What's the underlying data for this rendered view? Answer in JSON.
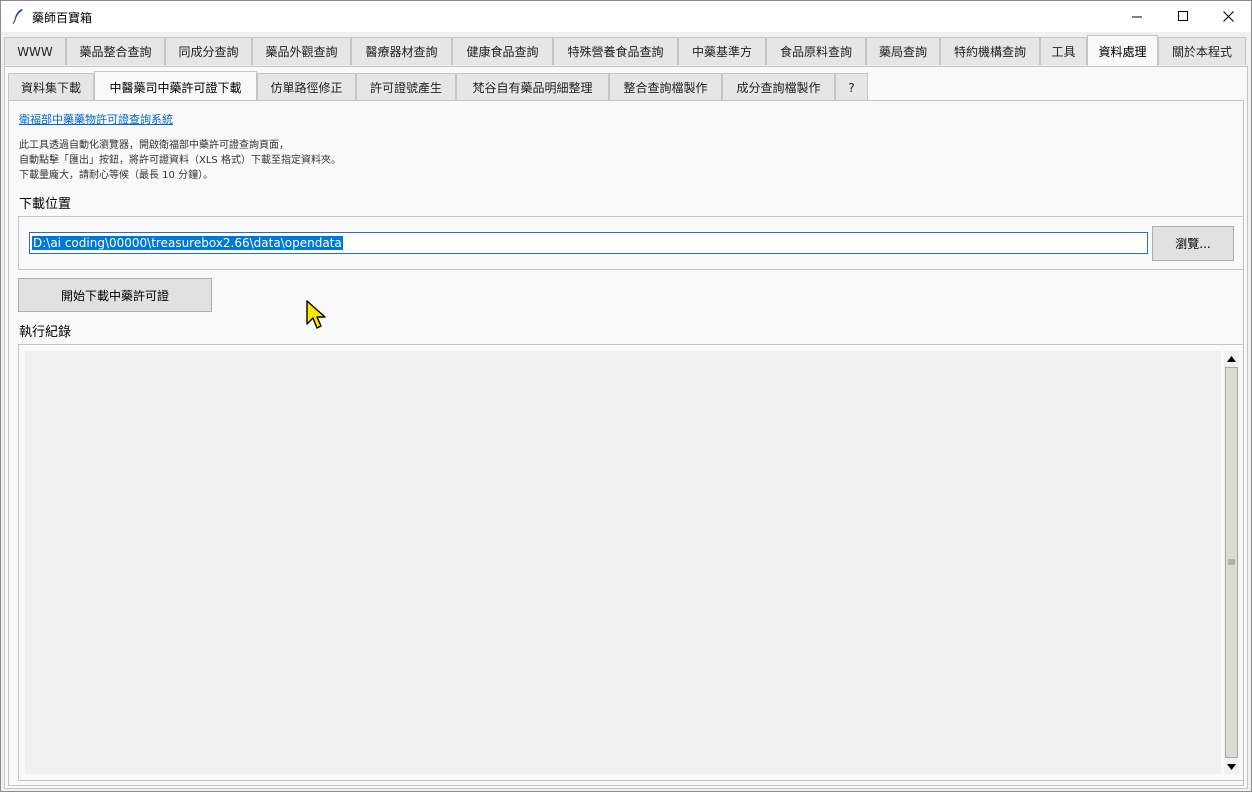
{
  "window": {
    "title": "藥師百寶箱",
    "icon": "feather-icon",
    "controls": [
      "minimize-icon",
      "maximize-icon",
      "close-icon"
    ]
  },
  "main_tabs": [
    {
      "label": "WWW",
      "selected": false
    },
    {
      "label": "藥品整合查詢",
      "selected": false
    },
    {
      "label": "同成分查詢",
      "selected": false
    },
    {
      "label": "藥品外觀查詢",
      "selected": false
    },
    {
      "label": "醫療器材查詢",
      "selected": false
    },
    {
      "label": "健康食品查詢",
      "selected": false
    },
    {
      "label": "特殊營養食品查詢",
      "selected": false
    },
    {
      "label": "中藥基準方",
      "selected": false
    },
    {
      "label": "食品原料查詢",
      "selected": false
    },
    {
      "label": "藥局查詢",
      "selected": false
    },
    {
      "label": "特約機構查詢",
      "selected": false
    },
    {
      "label": "工具",
      "selected": false
    },
    {
      "label": "資料處理",
      "selected": true
    },
    {
      "label": "關於本程式",
      "selected": false
    }
  ],
  "sub_tabs": [
    {
      "label": "資料集下載",
      "selected": false
    },
    {
      "label": "中醫藥司中藥許可證下載",
      "selected": true
    },
    {
      "label": "仿單路徑修正",
      "selected": false
    },
    {
      "label": "許可證號產生",
      "selected": false
    },
    {
      "label": "梵谷自有藥品明細整理",
      "selected": false
    },
    {
      "label": "整合查詢檔製作",
      "selected": false
    },
    {
      "label": "成分查詢檔製作",
      "selected": false
    },
    {
      "label": "?",
      "selected": false
    }
  ],
  "content": {
    "link_text": "衛福部中藥藥物許可證查詢系統",
    "description": [
      "此工具透過自動化瀏覽器，開啟衛福部中藥許可證查詢頁面，",
      "自動點擊「匯出」按鈕，將許可證資料（XLS 格式）下載至指定資料夾。",
      "下載量龐大，請耐心等候（最長 10 分鐘）。"
    ],
    "download_location_label": "下載位置",
    "download_path": "D:\\ai coding\\00000\\treasurebox2.66\\data\\opendata",
    "browse_button": "瀏覽...",
    "start_button": "開始下載中藥許可證",
    "log_label": "執行紀錄"
  },
  "colors": {
    "accent": "#0078d7",
    "link": "#0066cc",
    "cursor": "#ffe600"
  }
}
